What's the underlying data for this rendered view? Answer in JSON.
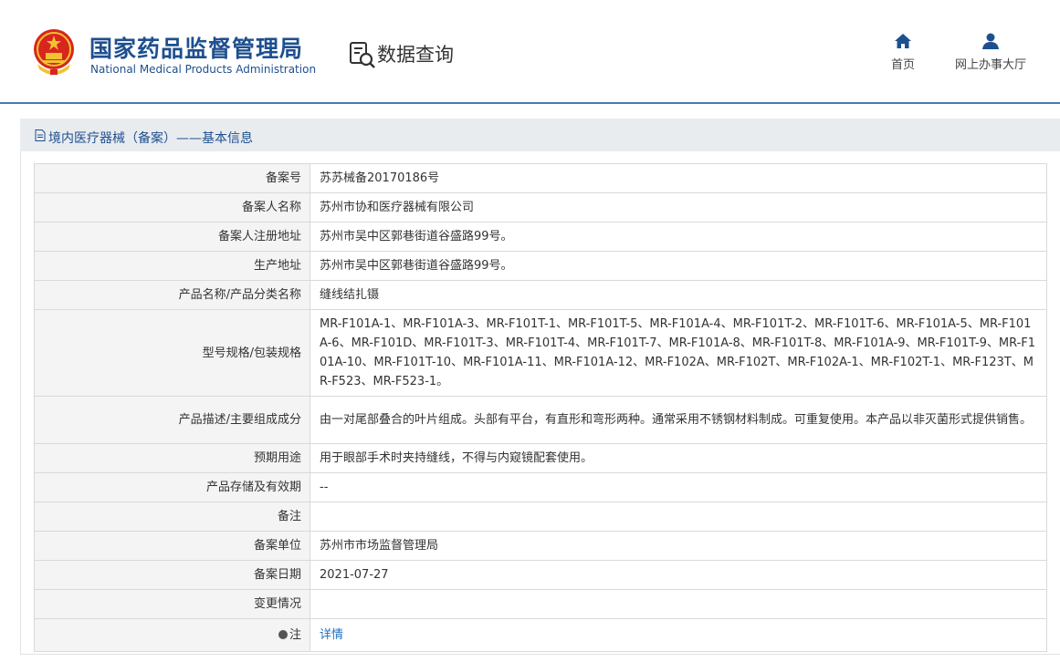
{
  "header": {
    "brand_cn": "国家药品监督管理局",
    "brand_en": "National Medical Products Administration",
    "section_title": "数据查询",
    "nav": {
      "home": "首页",
      "online_hall": "网上办事大厅"
    }
  },
  "page": {
    "title": "境内医疗器械（备案）——基本信息"
  },
  "fields": [
    {
      "label": "备案号",
      "value": "苏苏械备20170186号"
    },
    {
      "label": "备案人名称",
      "value": "苏州市协和医疗器械有限公司"
    },
    {
      "label": "备案人注册地址",
      "value": "苏州市吴中区郭巷街道谷盛路99号。"
    },
    {
      "label": "生产地址",
      "value": "苏州市吴中区郭巷街道谷盛路99号。"
    },
    {
      "label": "产品名称/产品分类名称",
      "value": "缝线结扎镊"
    },
    {
      "label": "型号规格/包装规格",
      "value": "MR-F101A-1、MR-F101A-3、MR-F101T-1、MR-F101T-5、MR-F101A-4、MR-F101T-2、MR-F101T-6、MR-F101A-5、MR-F101A-6、MR-F101D、MR-F101T-3、MR-F101T-4、MR-F101T-7、MR-F101A-8、MR-F101T-8、MR-F101A-9、MR-F101T-9、MR-F101A-10、MR-F101T-10、MR-F101A-11、MR-F101A-12、MR-F102A、MR-F102T、MR-F102A-1、MR-F102T-1、MR-F123T、MR-F523、MR-F523-1。"
    },
    {
      "label": "产品描述/主要组成成分",
      "value": "由一对尾部叠合的叶片组成。头部有平台，有直形和弯形两种。通常采用不锈钢材料制成。可重复使用。本产品以非灭菌形式提供销售。"
    },
    {
      "label": "预期用途",
      "value": "用于眼部手术时夹持缝线，不得与内窥镜配套使用。"
    },
    {
      "label": "产品存储及有效期",
      "value": "--"
    },
    {
      "label": "备注",
      "value": ""
    },
    {
      "label": "备案单位",
      "value": "苏州市市场监督管理局"
    },
    {
      "label": "备案日期",
      "value": "2021-07-27"
    },
    {
      "label": "变更情况",
      "value": ""
    }
  ],
  "note_row": {
    "label": "注",
    "link": "详情",
    "icon": "bulb-icon"
  },
  "colors": {
    "brand_blue": "#1e4f8f",
    "header_line": "#4a78b0",
    "link_blue": "#1e6fc2",
    "label_bg": "#f4f4f4",
    "title_bar_bg": "#e9ecef"
  }
}
